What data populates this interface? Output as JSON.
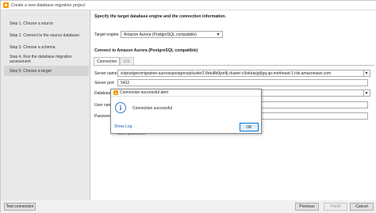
{
  "window": {
    "title": "Create a new database migration project"
  },
  "steps": [
    {
      "label": "Step 1. Choose a source"
    },
    {
      "label": "Step 2. Connect to the source database"
    },
    {
      "label": "Step 3. Choose a schema"
    },
    {
      "label": "Step 4. Run the database migration assessment"
    },
    {
      "label": "Step 5. Choose a target"
    }
  ],
  "main": {
    "heading": "Specify the target database engine and the connection information.",
    "target_engine_label": "Target engine:",
    "target_engine_value": "Amazon Aurora (PostgreSQL compatible)",
    "connect_heading": "Connect to Amazon Aurora (PostgreSQL compatible)",
    "tabs": [
      {
        "label": "Connection"
      },
      {
        "label": "SSL"
      }
    ],
    "server_name_label": "Server name",
    "server_name_value": "sctpostgresmigration-auroraspostgresqlcluster2-8etu8b9jzeflj.cluster-c5etutasjq5gq.ap-northeast-1.rds.amazonaws.com",
    "server_port_label": "Server port",
    "server_port_value": "5432",
    "database_label": "Database",
    "user_name_label": "User name",
    "password_label": "Password",
    "store_password_label": "Store password"
  },
  "footer": {
    "test_connection": "Test connection",
    "previous": "Previous",
    "finish": "Finish",
    "cancel": "Cancel"
  },
  "dialog": {
    "title": "Connection successful alert",
    "message": "Connection successful",
    "show_log": "Show Log",
    "ok": "OK"
  }
}
